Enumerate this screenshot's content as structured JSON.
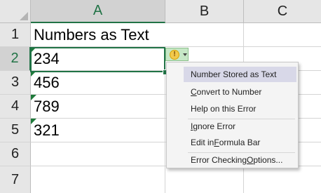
{
  "columns": [
    "A",
    "B",
    "C"
  ],
  "rows": [
    "1",
    "2",
    "3",
    "4",
    "5",
    "6",
    "7"
  ],
  "cells": {
    "a1": "Numbers as Text",
    "a2": "234",
    "a3": "456",
    "a4": "789",
    "a5": "321"
  },
  "menu": {
    "header": "Number Stored as Text",
    "convert_pre": "",
    "convert_u": "C",
    "convert_post": "onvert to Number",
    "help": "Help on this Error",
    "ignore_pre": "",
    "ignore_u": "I",
    "ignore_post": "gnore Error",
    "edit_pre": "Edit in ",
    "edit_u": "F",
    "edit_post": "ormula Bar",
    "options_pre": "Error Checking ",
    "options_u": "O",
    "options_post": "ptions..."
  },
  "colors": {
    "accent": "#217346",
    "error_triangle": "#1e7a3a",
    "warning": "#f2c94c"
  },
  "icons": {
    "error_button": "warning-icon"
  }
}
